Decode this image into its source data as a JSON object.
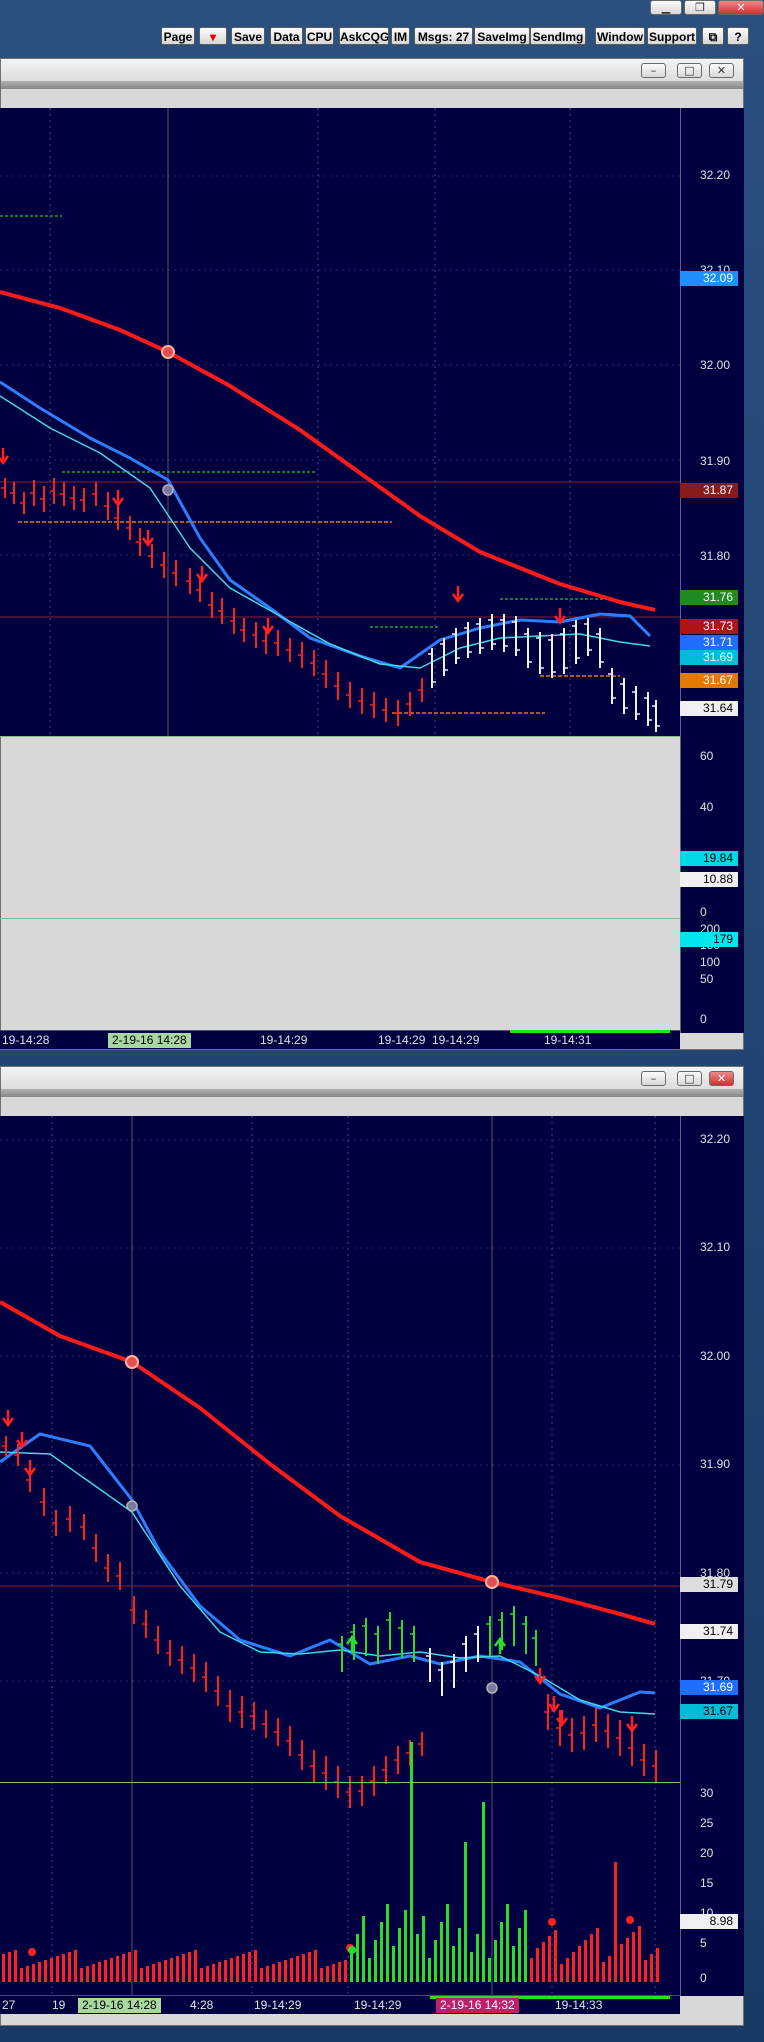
{
  "toolbar": {
    "buttons": [
      "Page",
      "",
      "Save",
      "Data",
      "CPU",
      "AskCQG",
      "IM",
      "Msgs: 27",
      "SaveImg",
      "SendImg",
      "Window",
      "Support"
    ]
  },
  "top": {
    "price_labels": [
      "32.20",
      "32.10",
      "32.00",
      "31.90",
      "31.80"
    ],
    "badges": [
      {
        "text": "32.09",
        "bg": "#1e90ff",
        "fg": "#ffffff"
      },
      {
        "text": "31.87",
        "bg": "#8b1a1a",
        "fg": "#ffffff"
      },
      {
        "text": "31.76",
        "bg": "#1f8a1f",
        "fg": "#ffffff"
      },
      {
        "text": "31.73",
        "bg": "#b01515",
        "fg": "#ffffff"
      },
      {
        "text": "31.71",
        "bg": "#1e6fff",
        "fg": "#ffffff"
      },
      {
        "text": "31.69",
        "bg": "#00bcd4",
        "fg": "#ffffff"
      },
      {
        "text": "31.67",
        "bg": "#e07b00",
        "fg": "#ffffff"
      },
      {
        "text": "31.64",
        "bg": "#f0f0f0",
        "fg": "#000000"
      }
    ],
    "osc_labels": [
      "60",
      "40",
      "20",
      "0"
    ],
    "osc_badges": [
      {
        "text": "19.84",
        "bg": "#00d8e8",
        "fg": "#000000"
      },
      {
        "text": "10.88",
        "bg": "#f0f0f0",
        "fg": "#000000"
      }
    ],
    "vol_labels": [
      "200",
      "150",
      "100",
      "50",
      "0"
    ],
    "vol_badge": {
      "text": "179",
      "bg": "#00e5ee",
      "fg": "#000000"
    },
    "time_labels": [
      "19-14:28",
      "19-14:29",
      "19-14:29",
      "19-14:29",
      "19-14:31"
    ],
    "time_highlight": "2-19-16  14:28"
  },
  "bottom": {
    "price_labels": [
      "32.20",
      "32.10",
      "32.00",
      "31.90",
      "31.80",
      "31.70"
    ],
    "badges": [
      {
        "text": "31.79",
        "bg": "#dddddd",
        "fg": "#000000"
      },
      {
        "text": "31.74",
        "bg": "#f0f0f0",
        "fg": "#000000"
      },
      {
        "text": "31.69",
        "bg": "#1e6fff",
        "fg": "#ffffff"
      },
      {
        "text": "31.67",
        "bg": "#00bcd4",
        "fg": "#000000"
      }
    ],
    "vol_labels": [
      "30",
      "25",
      "20",
      "15",
      "10",
      "5",
      "0"
    ],
    "vol_badge": {
      "text": "8.98",
      "bg": "#f0f0f0",
      "fg": "#000000"
    },
    "time_labels": [
      "27",
      "19",
      "4:28",
      "19-14:29",
      "19-14:29",
      "19-14:33"
    ],
    "time_highlight": "2-19-16  14:28",
    "time_highlight2": "2-19-16  14:32"
  }
}
